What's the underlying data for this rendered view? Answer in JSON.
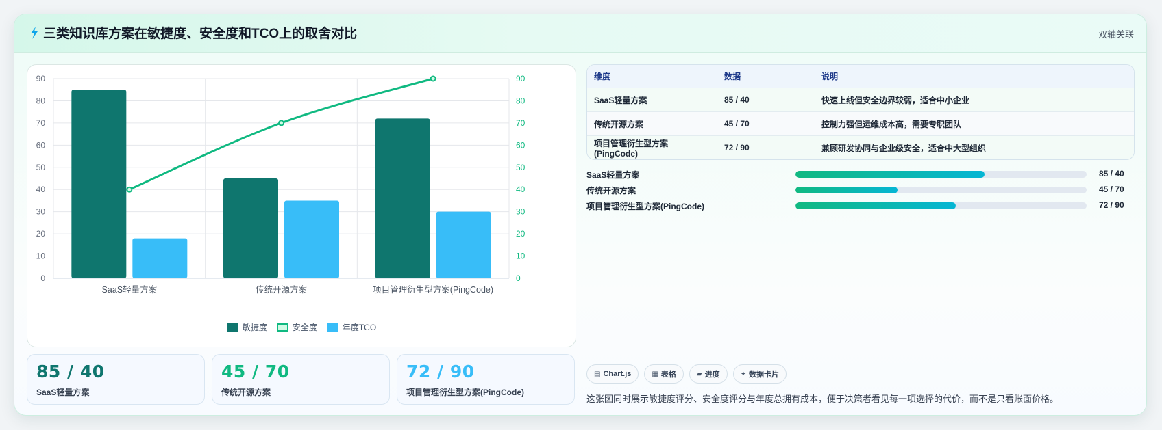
{
  "header": {
    "title": "三类知识库方案在敏捷度、安全度和TCO上的取舍对比",
    "link_label": "双轴关联"
  },
  "colors": {
    "agility": "#0f766e",
    "security": "#10b981",
    "tco": "#38bdf8"
  },
  "chart_data": {
    "type": "bar",
    "categories": [
      "SaaS轻量方案",
      "传统开源方案",
      "项目管理衍生型方案(PingCode)"
    ],
    "series": [
      {
        "name": "敏捷度",
        "type": "bar",
        "axis": "left",
        "values": [
          85,
          45,
          72
        ]
      },
      {
        "name": "安全度",
        "type": "line",
        "axis": "right",
        "values": [
          40,
          70,
          90
        ]
      },
      {
        "name": "年度TCO",
        "type": "bar",
        "axis": "left",
        "values": [
          18,
          35,
          30
        ]
      }
    ],
    "y_left": {
      "min": 0,
      "max": 90,
      "ticks": [
        0,
        10,
        20,
        30,
        40,
        50,
        60,
        70,
        80,
        90
      ]
    },
    "y_right": {
      "min": 0,
      "max": 90,
      "ticks": [
        0,
        10,
        20,
        30,
        40,
        50,
        60,
        70,
        80,
        90
      ]
    },
    "grid": true,
    "legend": "bottom"
  },
  "stats": [
    {
      "value": "85 / 40",
      "label": "SaaS轻量方案",
      "color": "#0f766e"
    },
    {
      "value": "45 / 70",
      "label": "传统开源方案",
      "color": "#10b981"
    },
    {
      "value": "72 / 90",
      "label": "项目管理衍生型方案(PingCode)",
      "color": "#38bdf8"
    }
  ],
  "table": {
    "headers": [
      "维度",
      "数据",
      "说明"
    ],
    "rows": [
      [
        "SaaS轻量方案",
        "85 / 40",
        "快速上线但安全边界较弱，适合中小企业"
      ],
      [
        "传统开源方案",
        "45 / 70",
        "控制力强但运维成本高，需要专职团队"
      ],
      [
        "项目管理衍生型方案(PingCode)",
        "72 / 90",
        "兼顾研发协同与企业级安全，适合中大型组织"
      ]
    ]
  },
  "progress": [
    {
      "label": "SaaS轻量方案",
      "value": "85 / 40",
      "fraction": 0.65
    },
    {
      "label": "传统开源方案",
      "value": "45 / 70",
      "fraction": 0.35
    },
    {
      "label": "项目管理衍生型方案(PingCode)",
      "value": "72 / 90",
      "fraction": 0.55
    }
  ],
  "chips": [
    {
      "icon": "▤",
      "label": "Chart.js",
      "icon_name": "chart-icon"
    },
    {
      "icon": "▦",
      "label": "表格",
      "icon_name": "table-icon"
    },
    {
      "icon": "▰",
      "label": "进度",
      "icon_name": "progress-icon"
    },
    {
      "icon": "✦",
      "label": "数据卡片",
      "icon_name": "sparkle-icon"
    }
  ],
  "description": "这张图同时展示敏捷度评分、安全度评分与年度总拥有成本，便于决策者看见每一项选择的代价，而不是只看账面价格。"
}
